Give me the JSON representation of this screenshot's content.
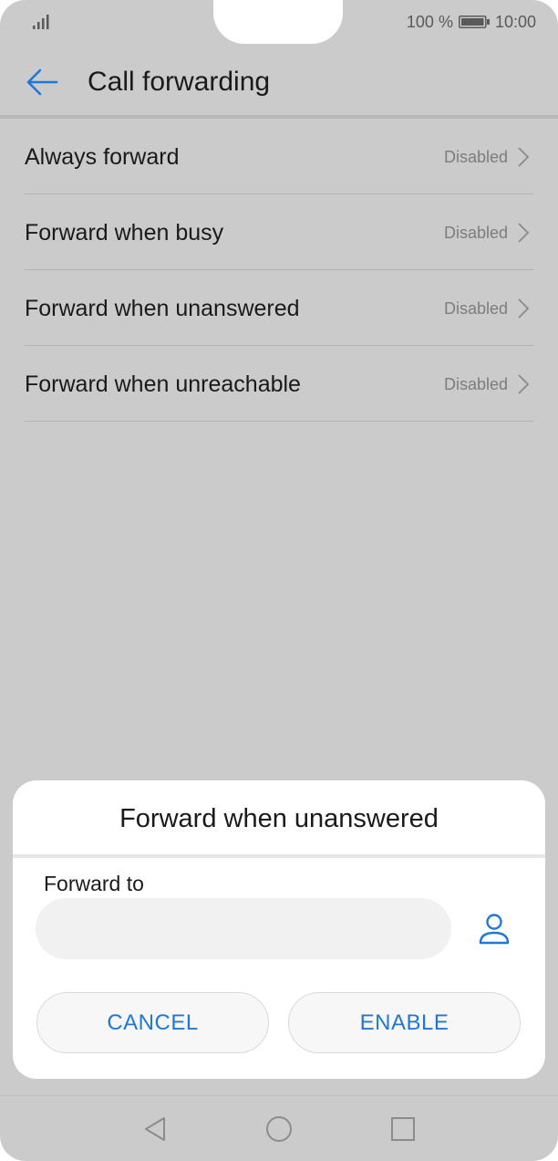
{
  "status_bar": {
    "battery_percent": "100 %",
    "time": "10:00"
  },
  "header": {
    "title": "Call forwarding"
  },
  "list": {
    "items": [
      {
        "label": "Always forward",
        "status": "Disabled"
      },
      {
        "label": "Forward when busy",
        "status": "Disabled"
      },
      {
        "label": "Forward when unanswered",
        "status": "Disabled"
      },
      {
        "label": "Forward when unreachable",
        "status": "Disabled"
      }
    ]
  },
  "dialog": {
    "title": "Forward when unanswered",
    "field_label": "Forward to",
    "field_value": "",
    "cancel_label": "CANCEL",
    "enable_label": "ENABLE"
  },
  "icons": {
    "back": "back-arrow-icon",
    "chevron": "chevron-right-icon",
    "contact": "contact-person-icon",
    "nav_back": "triangle-back-icon",
    "nav_home": "circle-home-icon",
    "nav_recents": "square-recents-icon"
  },
  "colors": {
    "accent": "#1f78d8",
    "overlay_background": "#cbcbcb",
    "dialog_background": "#ffffff",
    "disabled_text": "#7d7d7d"
  }
}
